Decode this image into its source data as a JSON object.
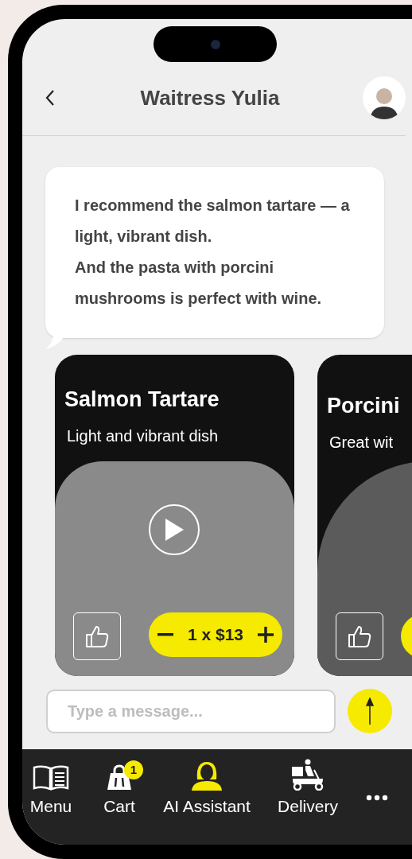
{
  "header": {
    "title": "Waitress Yulia"
  },
  "message": {
    "paragraphs": [
      "I recommend the salmon tartare — a light, vibrant dish.",
      "And the pasta with porcini mushrooms is perfect with wine."
    ]
  },
  "dishes": [
    {
      "title": "Salmon Tartare",
      "subtitle": "Light and vibrant dish",
      "video": true,
      "quantity": "1 x $13"
    },
    {
      "title": "Porcini",
      "subtitle": "Great wit",
      "video": false
    }
  ],
  "composer": {
    "placeholder": "Type a message..."
  },
  "nav": [
    {
      "kind": "menu",
      "label": "Menu",
      "selected": false
    },
    {
      "kind": "cart",
      "label": "Cart",
      "selected": false,
      "badge": "1"
    },
    {
      "kind": "assistant",
      "label": "AI Assistant",
      "selected": true
    },
    {
      "kind": "delivery",
      "label": "Delivery",
      "selected": false
    },
    {
      "kind": "more",
      "selected": false
    }
  ]
}
